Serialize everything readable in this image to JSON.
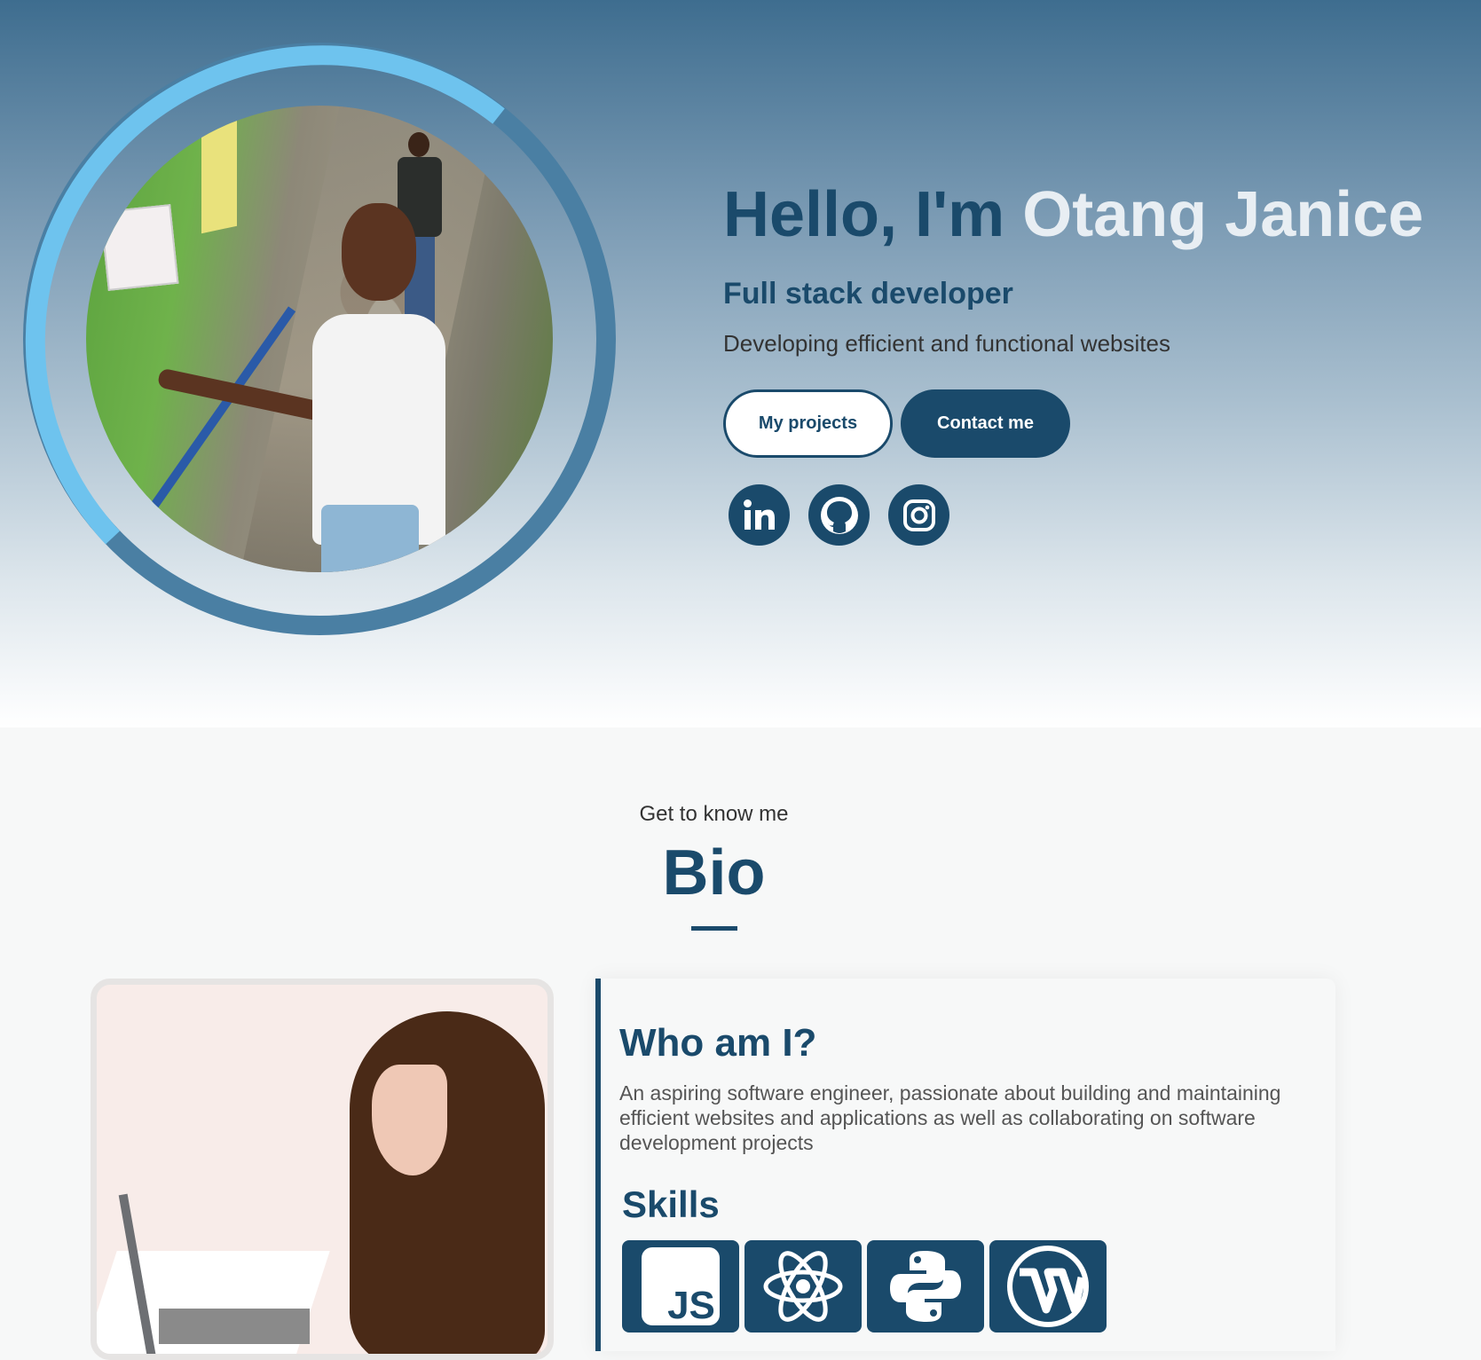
{
  "hero": {
    "greeting": "Hello, I'm",
    "name": "Otang Janice",
    "role": "Full stack developer",
    "tagline": "Developing efficient and functional websites",
    "buttons": {
      "projects": "My projects",
      "contact": "Contact me"
    },
    "socials": [
      "linkedin-icon",
      "github-icon",
      "instagram-icon"
    ]
  },
  "bio": {
    "eyebrow": "Get to know me",
    "title": "Bio",
    "who_title": "Who am I?",
    "about": "An aspiring software engineer, passionate about building and maintaining efficient websites and applications as well as collaborating on software development projects",
    "skills_title": "Skills",
    "skills": [
      "javascript-icon",
      "react-icon",
      "python-icon",
      "wordpress-icon"
    ],
    "js_label": "JS"
  },
  "colors": {
    "primary": "#1a4a6b",
    "ring_light": "#6ec3ee",
    "ring_dark": "#4a7fa3"
  }
}
